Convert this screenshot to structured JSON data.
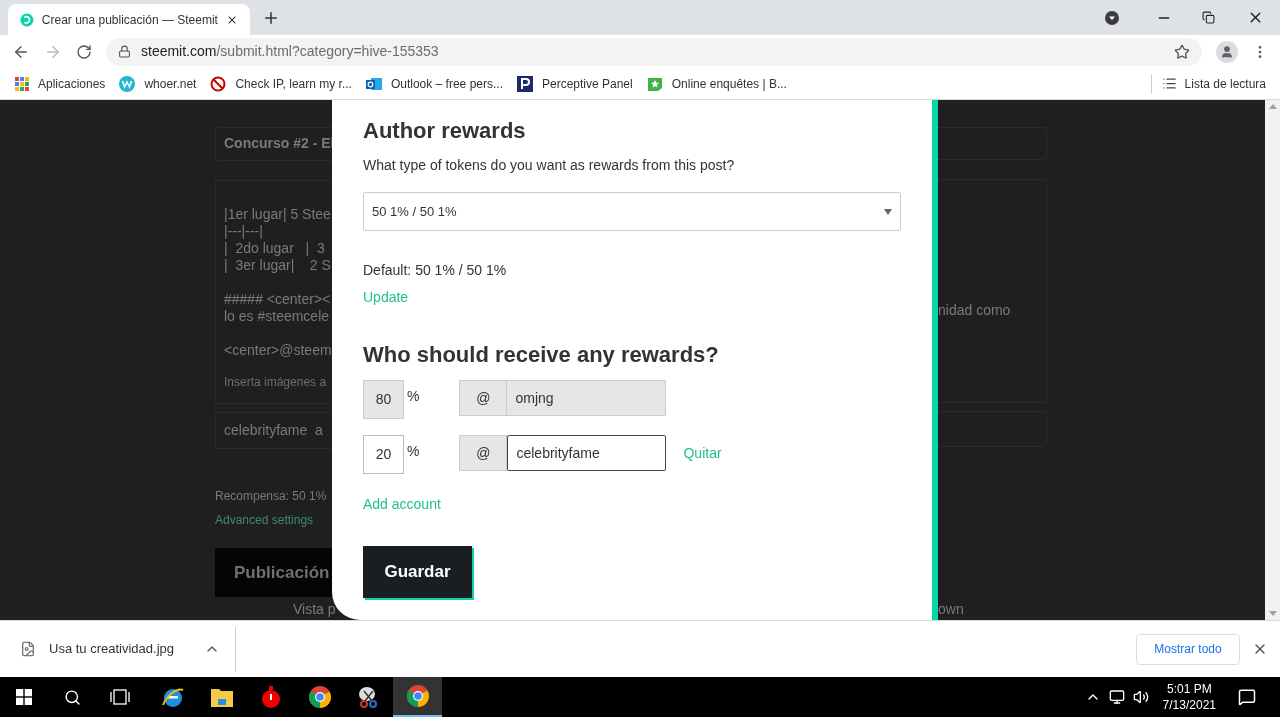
{
  "browser": {
    "tab_title": "Crear una publicación — Steemit",
    "address": {
      "host": "steemit.com",
      "path": "/submit.html?category=hive-155353"
    },
    "bookmarks": [
      {
        "kind": "apps",
        "label": "Aplicaciones"
      },
      {
        "kind": "w",
        "label": "whoer.net"
      },
      {
        "kind": "noentry",
        "label": "Check IP, learn my r..."
      },
      {
        "kind": "outlook",
        "label": "Outlook – free pers..."
      },
      {
        "kind": "p",
        "label": "Perceptive Panel"
      },
      {
        "kind": "star",
        "label": "Online enquêtes | B..."
      }
    ],
    "reading_list": "Lista de lectura"
  },
  "background_page": {
    "title_field": "Concurso #2 - El",
    "body_paragraphs": [
      [
        "|1er lugar| 5 Stee",
        "|---|---|",
        "|  2do lugar   |  3",
        "|  3er lugar|    2 S"
      ],
      [
        "##### <center><",
        "lo es #steemcele"
      ],
      [
        "<center>@steem"
      ]
    ],
    "body_tail": "nidad como",
    "upload_hint": "Inserta imágenes a",
    "tags_field": "celebrityfame  a",
    "reward_line": "Recompensa: 50 1%",
    "advanced_link": "Advanced settings",
    "publish_button": "Publicación",
    "preview_label": "Vista p",
    "preview_tail": "own"
  },
  "modal": {
    "author_rewards": {
      "heading": "Author rewards",
      "question": "What type of tokens do you want as rewards from this post?",
      "select_value": "50 1% / 50 1%",
      "default_text": "Default: 50 1% / 50 1%",
      "update_link": "Update"
    },
    "beneficiaries": {
      "heading": "Who should receive any rewards?",
      "rows": [
        {
          "percent": "80",
          "percent_sign": "%",
          "at": "@",
          "account": "omjng",
          "disabled": true
        },
        {
          "percent": "20",
          "percent_sign": "%",
          "at": "@",
          "account": "celebrityfame",
          "disabled": false,
          "remove_label": "Quitar"
        }
      ],
      "add_account": "Add account"
    },
    "save_button": "Guardar"
  },
  "download_bar": {
    "file": "Usa tu creatividad.jpg",
    "show_all": "Mostrar todo"
  },
  "taskbar": {
    "apps": [
      {
        "kind": "ie",
        "selected": false
      },
      {
        "kind": "folder",
        "selected": false
      },
      {
        "kind": "timer",
        "selected": false
      },
      {
        "kind": "chrome",
        "selected": false
      },
      {
        "kind": "snip",
        "selected": false
      },
      {
        "kind": "chrome",
        "selected": true
      }
    ],
    "time": "5:01 PM",
    "date": "7/13/2021"
  }
}
